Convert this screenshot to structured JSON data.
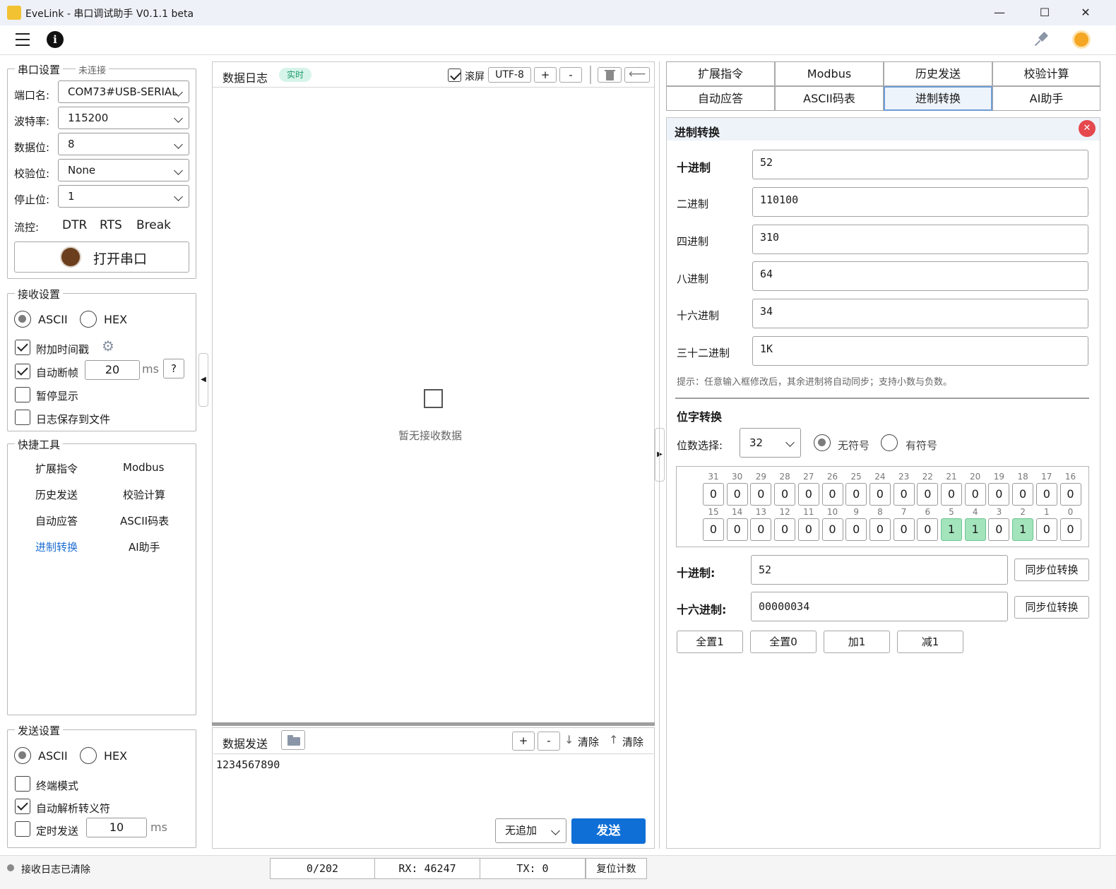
{
  "window": {
    "title": "EveLink - 串口调试助手 V0.1.1 beta",
    "minimize": "—",
    "maximize": "☐",
    "close": "✕"
  },
  "serial": {
    "legend": "串口设置",
    "status": "未连接",
    "port_label": "端口名:",
    "port_value": "COM73#USB-SERIAL",
    "baud_label": "波特率:",
    "baud_value": "115200",
    "databits_label": "数据位:",
    "databits_value": "8",
    "parity_label": "校验位:",
    "parity_value": "None",
    "stopbits_label": "停止位:",
    "stopbits_value": "1",
    "flow_label": "流控:",
    "dtr": "DTR",
    "rts": "RTS",
    "brk": "Break",
    "open_label": "打开串口",
    "indicator_color": "#6b3f1d"
  },
  "receive": {
    "legend": "接收设置",
    "ascii": "ASCII",
    "hex": "HEX",
    "timestamp": "附加时间戳",
    "auto_frame": "自动断帧",
    "frame_ms": "20",
    "ms": "ms",
    "help": "?",
    "pause": "暂停显示",
    "save_file": "日志保存到文件"
  },
  "quick": {
    "legend": "快捷工具",
    "items": [
      "扩展指令",
      "Modbus",
      "历史发送",
      "校验计算",
      "自动应答",
      "ASCII码表",
      "进制转换",
      "AI助手"
    ],
    "active_index": 6,
    "active_color": "#1f6fd1"
  },
  "send_settings": {
    "legend": "发送设置",
    "ascii": "ASCII",
    "hex": "HEX",
    "terminal": "终端模式",
    "escape": "自动解析转义符",
    "timed": "定时发送",
    "timed_ms": "10",
    "ms": "ms"
  },
  "log": {
    "title": "数据日志",
    "badge": "实时",
    "scroll": "滚屏",
    "encoding": "UTF-8",
    "plus": "+",
    "minus": "-",
    "empty": "暂无接收数据"
  },
  "send": {
    "title": "数据发送",
    "plus": "+",
    "minus": "-",
    "clear_down": "清除",
    "clear_up": "清除",
    "content": "1234567890",
    "append": "无追加",
    "send_button": "发送",
    "send_color": "#0f6fd6"
  },
  "tabs": [
    "扩展指令",
    "Modbus",
    "历史发送",
    "校验计算",
    "自动应答",
    "ASCII码表",
    "进制转换",
    "AI助手"
  ],
  "active_tab": 6,
  "convert": {
    "title": "进制转换",
    "rows": [
      {
        "label": "十进制",
        "value": "52"
      },
      {
        "label": "二进制",
        "value": "110100"
      },
      {
        "label": "四进制",
        "value": "310"
      },
      {
        "label": "八进制",
        "value": "64"
      },
      {
        "label": "十六进制",
        "value": "34"
      },
      {
        "label": "三十二进制",
        "value": "1K"
      }
    ],
    "hint": "提示：任意输入框修改后，其余进制将自动同步；支持小数与负数。"
  },
  "bits": {
    "title": "位字转换",
    "width_label": "位数选择:",
    "width_value": "32",
    "unsigned": "无符号",
    "signed": "有符号",
    "high_labels": [
      "31",
      "30",
      "29",
      "28",
      "27",
      "26",
      "25",
      "24",
      "23",
      "22",
      "21",
      "20",
      "19",
      "18",
      "17",
      "16"
    ],
    "high_values": [
      "0",
      "0",
      "0",
      "0",
      "0",
      "0",
      "0",
      "0",
      "0",
      "0",
      "0",
      "0",
      "0",
      "0",
      "0",
      "0"
    ],
    "low_labels": [
      "15",
      "14",
      "13",
      "12",
      "11",
      "10",
      "9",
      "8",
      "7",
      "6",
      "5",
      "4",
      "3",
      "2",
      "1",
      "0"
    ],
    "low_values": [
      "0",
      "0",
      "0",
      "0",
      "0",
      "0",
      "0",
      "0",
      "0",
      "0",
      "1",
      "1",
      "0",
      "1",
      "0",
      "0"
    ],
    "dec_label": "十进制:",
    "dec_value": "52",
    "hex_label": "十六进制:",
    "hex_value": "00000034",
    "sync": "同步位转换",
    "actions": [
      "全置1",
      "全置0",
      "加1",
      "减1"
    ]
  },
  "status": {
    "message": "接收日志已清除",
    "count": "0/202",
    "rx": "RX: 46247",
    "tx": "TX: 0",
    "reset": "复位计数"
  }
}
